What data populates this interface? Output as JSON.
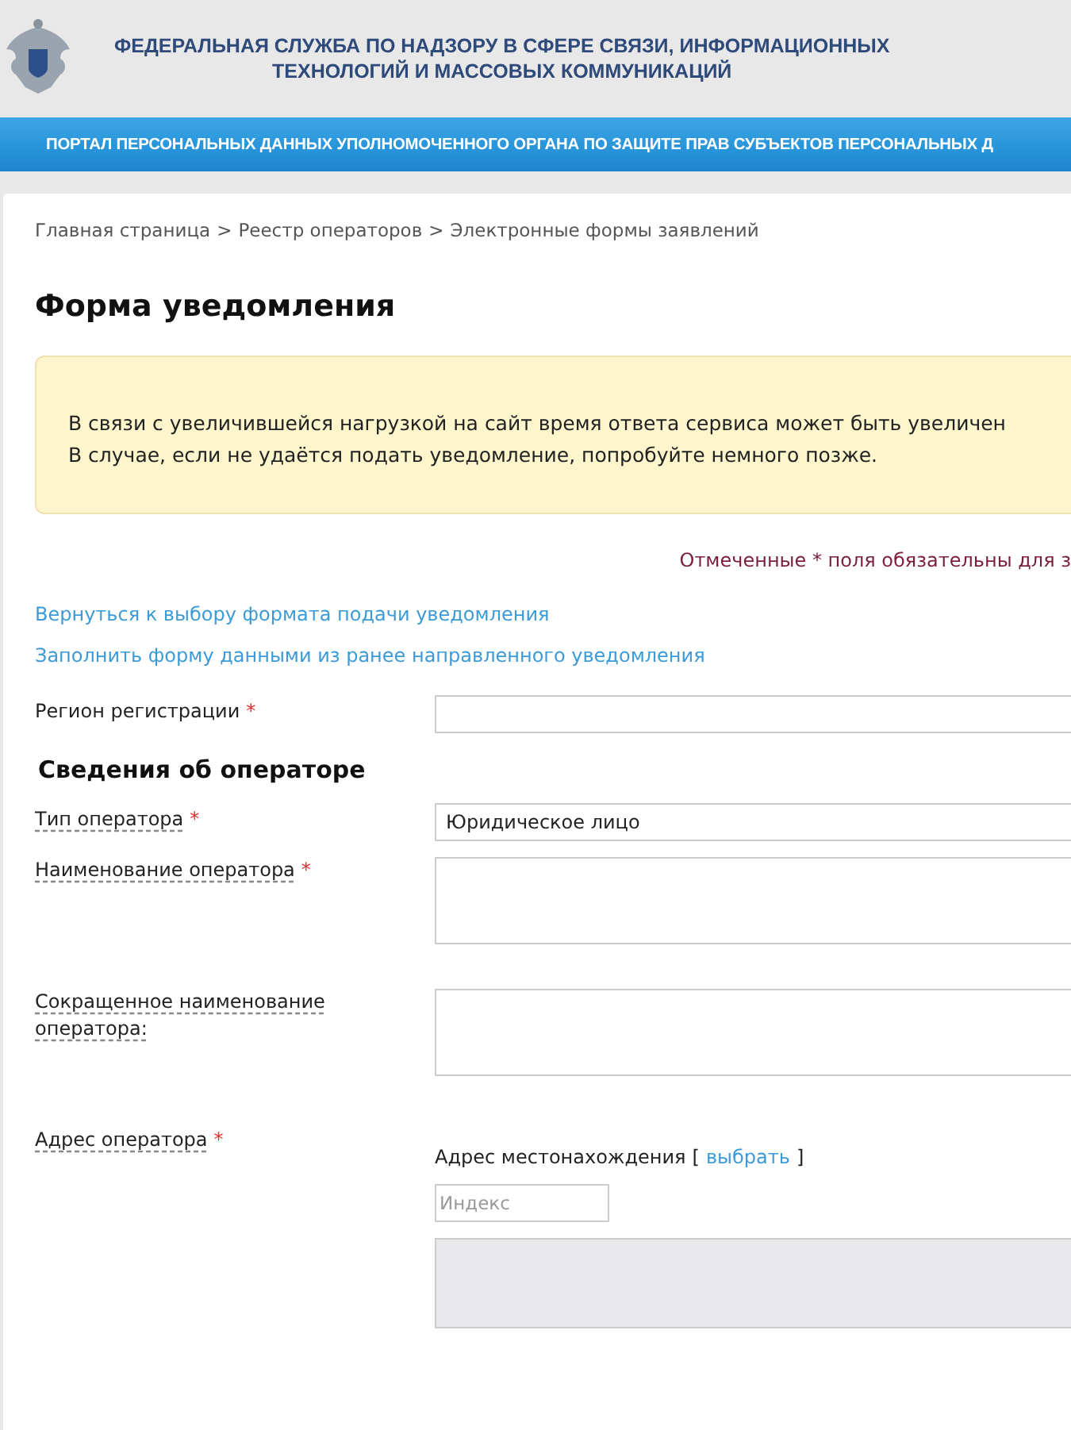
{
  "header": {
    "title_line_1": "ФЕДЕРАЛЬНАЯ СЛУЖБА ПО НАДЗОРУ В СФЕРЕ СВЯЗИ, ИНФОРМАЦИОННЫХ",
    "title_line_2": "ТЕХНОЛОГИЙ И МАССОВЫХ КОММУНИКАЦИЙ"
  },
  "banner": "ПОРТАЛ ПЕРСОНАЛЬНЫХ ДАННЫХ УПОЛНОМОЧЕННОГО ОРГАНА ПО ЗАЩИТЕ ПРАВ СУБЪЕКТОВ ПЕРСОНАЛЬНЫХ Д",
  "breadcrumbs": [
    {
      "label": "Главная страница"
    },
    {
      "label": "Реестр операторов"
    },
    {
      "label": "Электронные формы заявлений"
    }
  ],
  "breadcrumb_separator": ">",
  "page_title": "Форма уведомления",
  "notice": [
    "В связи с увеличившейся нагрузкой на сайт время ответа сервиса может быть увеличен",
    "В случае, если не удаётся подать уведомление, попробуйте немного позже."
  ],
  "required_note": "Отмеченные * поля обязательны для з",
  "links": [
    "Вернуться к выбору формата подачи уведомления",
    "Заполнить форму данными из ранее направленного уведомления"
  ],
  "fields": [
    {
      "kind": "input",
      "label": "Регион регистрации",
      "required": true,
      "underlined": false
    },
    {
      "kind": "heading",
      "label": "Сведения об операторе"
    },
    {
      "kind": "input",
      "label": "Тип оператора",
      "required": true,
      "underlined": true,
      "value": "Юридическое лицо"
    },
    {
      "kind": "textarea",
      "label": "Наименование оператора",
      "required": true,
      "underlined": true
    },
    {
      "kind": "textarea",
      "label": "Сокращенное наименование оператора:",
      "required": false,
      "underlined": true
    },
    {
      "kind": "address",
      "label": "Адрес оператора",
      "required": true,
      "underlined": true,
      "address_label": "Адрес местонахождения",
      "open_bracket": "[",
      "choose_link": "выбрать",
      "close_bracket": "]",
      "index_placeholder": "Индекс"
    }
  ],
  "required_mark": "*"
}
